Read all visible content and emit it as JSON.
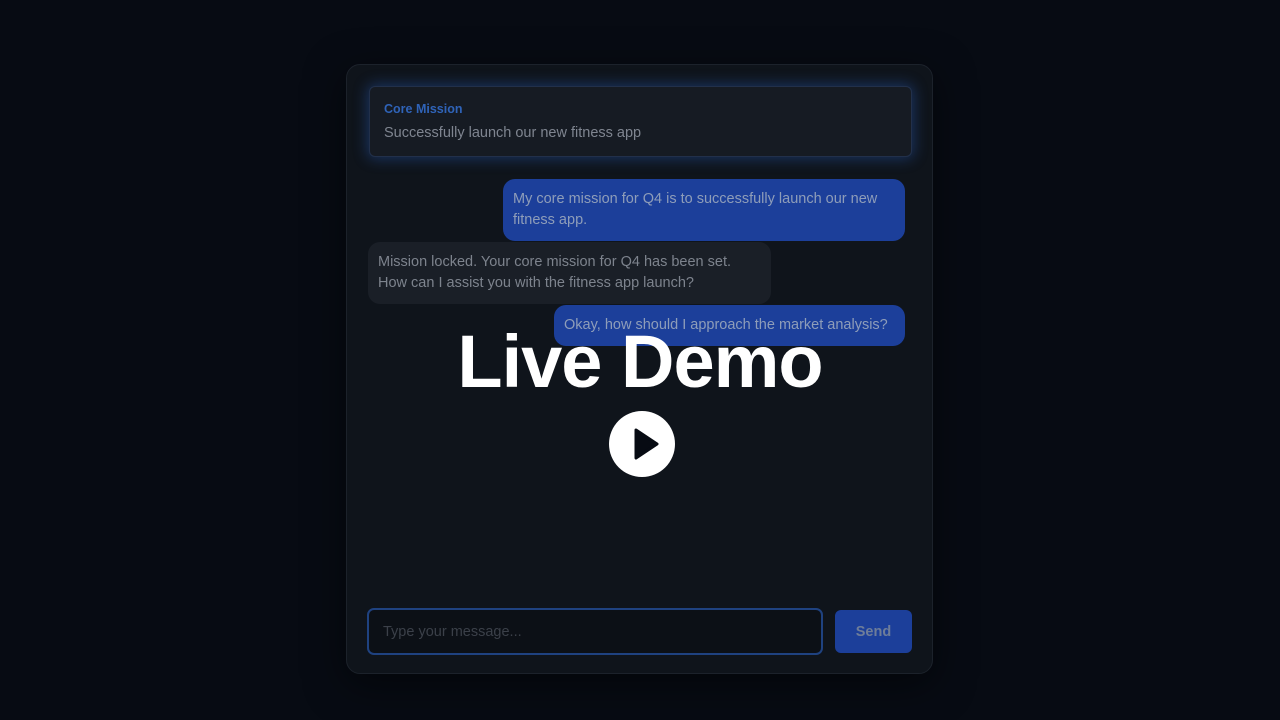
{
  "mission": {
    "label": "Core Mission",
    "text": "Successfully launch our new fitness app"
  },
  "messages": [
    {
      "role": "user",
      "text": "My core mission for Q4 is to successfully launch our new fitness app."
    },
    {
      "role": "assistant",
      "text": "Mission locked. Your core mission for Q4 has been set. How can I assist you with the fitness app launch?"
    },
    {
      "role": "user",
      "text": "Okay, how should I approach the market analysis?"
    }
  ],
  "composer": {
    "placeholder": "Type your message...",
    "value": "",
    "send_label": "Send"
  },
  "overlay": {
    "title": "Live Demo",
    "play_icon": "play-icon"
  },
  "colors": {
    "accent": "#1c3f9a",
    "mission_label": "#2f63b8",
    "background": "#070b13"
  }
}
